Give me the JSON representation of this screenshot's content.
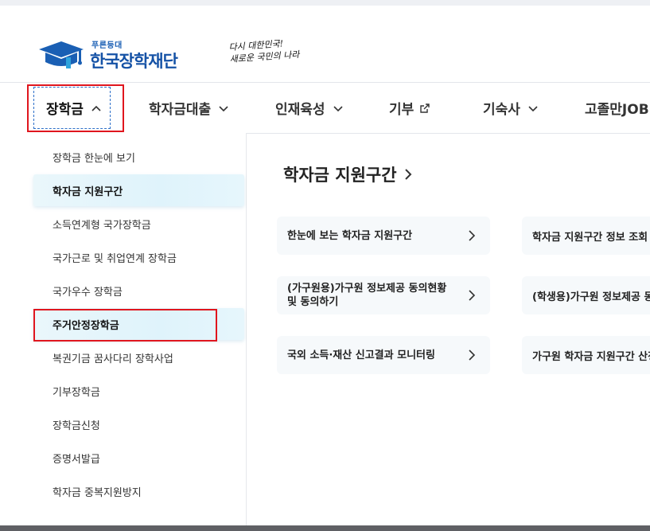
{
  "header": {
    "logo_small": "푸른등대",
    "logo_main": "한국장학재단",
    "slogan_line1": "다시 대한민국!",
    "slogan_line2": "새로운 국민의 나라"
  },
  "nav": {
    "items": [
      {
        "label": "장학금",
        "icon": "chevron-up-icon"
      },
      {
        "label": "학자금대출",
        "icon": "chevron-down-icon"
      },
      {
        "label": "인재육성",
        "icon": "chevron-down-icon"
      },
      {
        "label": "기부",
        "icon": "external-link-icon"
      },
      {
        "label": "기숙사",
        "icon": "chevron-down-icon"
      },
      {
        "label": "고졸만JOB"
      }
    ]
  },
  "sidebar": {
    "items": [
      {
        "label": "장학금 한눈에 보기"
      },
      {
        "label": "학자금 지원구간"
      },
      {
        "label": "소득연계형 국가장학금"
      },
      {
        "label": "국가근로 및 취업연계 장학금"
      },
      {
        "label": "국가우수 장학금"
      },
      {
        "label": "주거안정장학금"
      },
      {
        "label": "복권기금 꿈사다리 장학사업"
      },
      {
        "label": "기부장학금"
      },
      {
        "label": "장학금신청"
      },
      {
        "label": "증명서발급"
      },
      {
        "label": "학자금 중복지원방지"
      }
    ]
  },
  "main": {
    "title": "학자금 지원구간",
    "cards": [
      {
        "label": "한눈에 보는 학자금 지원구간"
      },
      {
        "label": "학자금 지원구간 정보 조회"
      },
      {
        "label": "(가구원용)가구원 정보제공 동의현황 및 동의하기"
      },
      {
        "label": "(학생용)가구원 정보제공 동의"
      },
      {
        "label": "국외 소득·재산 신고결과 모니터링"
      },
      {
        "label": "가구원 학자금 지원구간 산정"
      }
    ]
  },
  "colors": {
    "brand_blue": "#1552a6",
    "highlight_red": "#e0161e",
    "active_bg": "#dff3fb",
    "card_bg": "#f6f9fb"
  }
}
